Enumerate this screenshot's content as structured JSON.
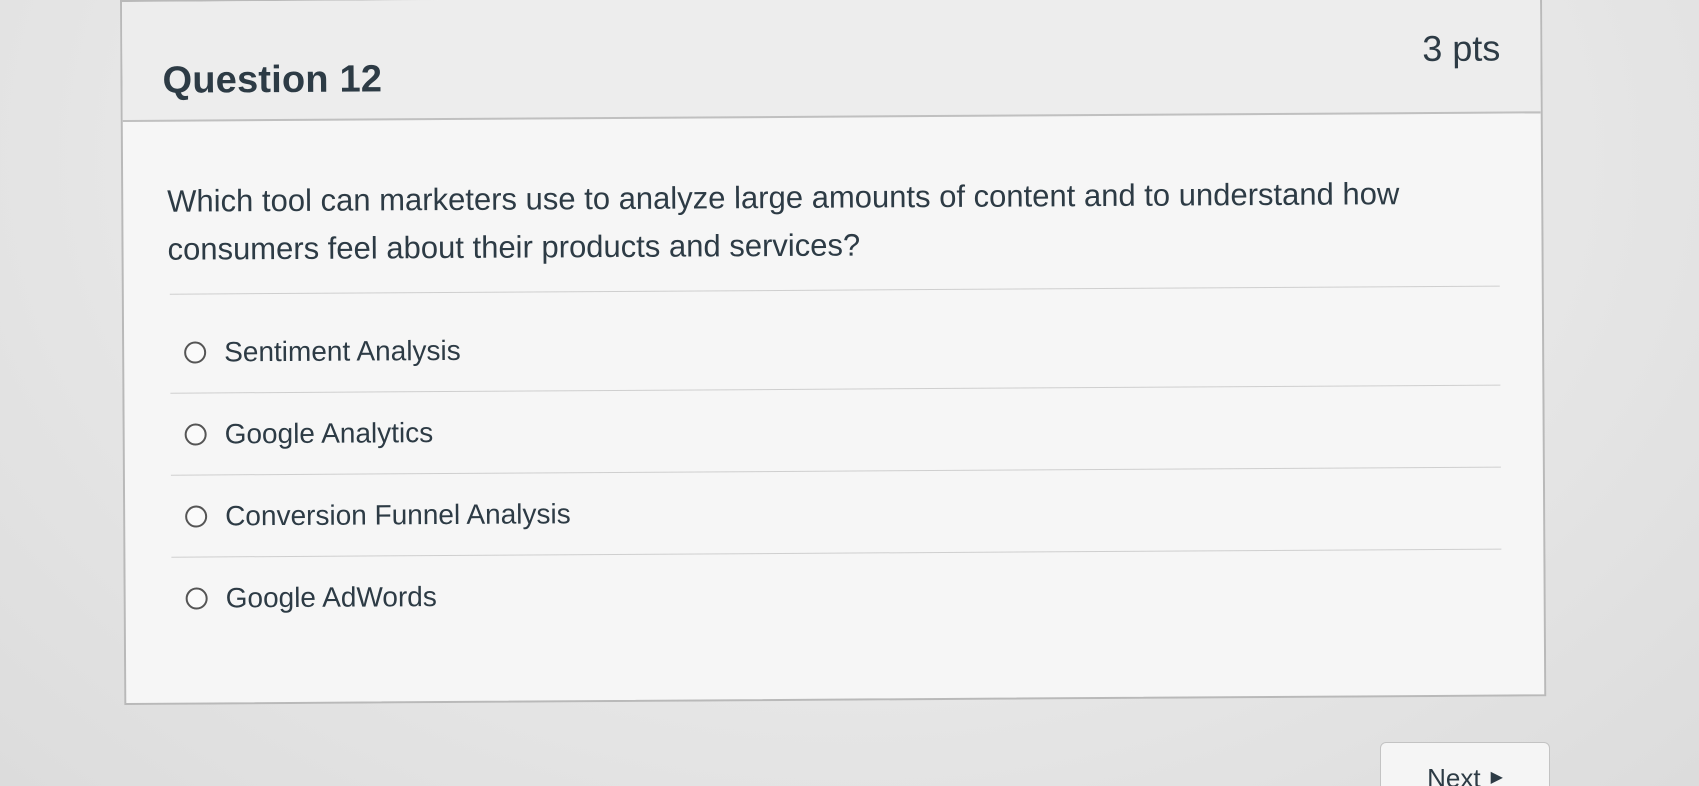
{
  "question": {
    "title": "Question 12",
    "points": "3 pts",
    "text": "Which tool can marketers use to analyze large amounts of content and to understand how consumers feel about their products and services?",
    "answers": [
      {
        "label": "Sentiment Analysis",
        "selected": false
      },
      {
        "label": "Google Analytics",
        "selected": false
      },
      {
        "label": "Conversion Funnel Analysis",
        "selected": false
      },
      {
        "label": "Google AdWords",
        "selected": false
      }
    ]
  },
  "navigation": {
    "next_label": "Next",
    "next_icon": "triangle-right-icon"
  }
}
